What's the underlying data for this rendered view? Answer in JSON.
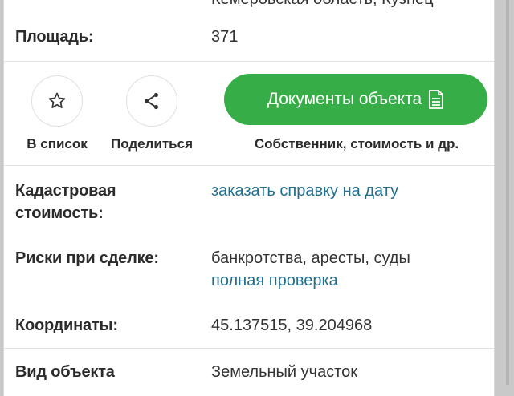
{
  "top_partial_text": "Кемеровская область, Кузнец",
  "rows": {
    "area": {
      "label": "Площадь:",
      "value": "371"
    },
    "cadastral": {
      "label_line1": "Кадастровая",
      "label_line2": "стоимость:",
      "link": "заказать справку на дату"
    },
    "risks": {
      "label": "Риски при сделке:",
      "value": "банкротства, аресты, суды",
      "link": "полная проверка"
    },
    "coords": {
      "label": "Координаты:",
      "value": "45.137515, 39.204968"
    },
    "object_type": {
      "label": "Вид объекта",
      "value": "Земельный участок"
    }
  },
  "actions": {
    "favorite_label": "В список",
    "share_label": "Поделиться",
    "documents_label": "Документы объекта",
    "documents_subtitle": "Собственник, стоимость и др."
  },
  "icons": {
    "favorite": "star-icon",
    "share": "share-icon",
    "documents": "document-icon"
  },
  "colors": {
    "accent_green": "#36ad46",
    "link_blue": "#1f6f8f"
  }
}
